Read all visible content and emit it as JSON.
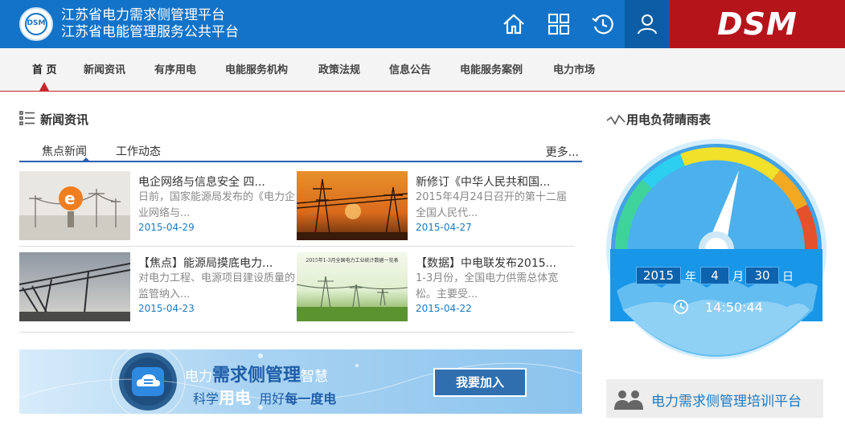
{
  "header": {
    "logo_text": "DSM",
    "title_line1": "江苏省电力需求侧管理平台",
    "title_line2": "江苏省电能管理服务公共平台",
    "brand": "DSM"
  },
  "nav": {
    "items": [
      "首 页",
      "新闻资讯",
      "有序用电",
      "电能服务机构",
      "政策法规",
      "信息公告",
      "电能服务案例",
      "电力市场"
    ],
    "active_index": 0
  },
  "news_section": {
    "title": "新闻资讯",
    "tabs": [
      "焦点新闻",
      "工作动态"
    ],
    "active_tab": 0,
    "more": "更多...",
    "items": [
      {
        "title": "电企网络与信息安全 四...",
        "desc": "日前，国家能源局发布的《电力企业网络与...",
        "date": "2015-04-29"
      },
      {
        "title": "新修订《中华人民共和国...",
        "desc": "2015年4月24日召开的第十二届全国人民代...",
        "date": "2015-04-27"
      },
      {
        "title": "【焦点】能源局摸底电力...",
        "desc": "对电力工程、电源项目建设质量的监管纳入...",
        "date": "2015-04-23"
      },
      {
        "title": "【数据】中电联发布2015...",
        "desc": "1-3月份，全国电力供需总体宽松。主要受...",
        "date": "2015-04-22",
        "thumb_caption": "2015年1-3月全国电力工业统计数据一览表"
      }
    ]
  },
  "banner": {
    "line1_a": "电力",
    "line1_b": "需求侧管理",
    "line1_c": "智慧",
    "line2_a": "科学",
    "line2_b": "用电",
    "line2_c": "用好",
    "line2_d": "每一度电",
    "join_label": "我要加入"
  },
  "load_section": {
    "title": "用电负荷晴雨表",
    "year": "2015",
    "year_unit": "年",
    "month": "4",
    "month_unit": "月",
    "day": "30",
    "day_unit": "日",
    "time": "14:50:44",
    "load_level": 0.55
  },
  "training": {
    "label": "电力需求侧管理培训平台"
  },
  "colors": {
    "header_blue": "#1273c8",
    "brand_red": "#b5141b",
    "nav_accent": "#c8262c",
    "link_blue": "#1f7ac2",
    "gauge_blue": "#41a3e6"
  }
}
